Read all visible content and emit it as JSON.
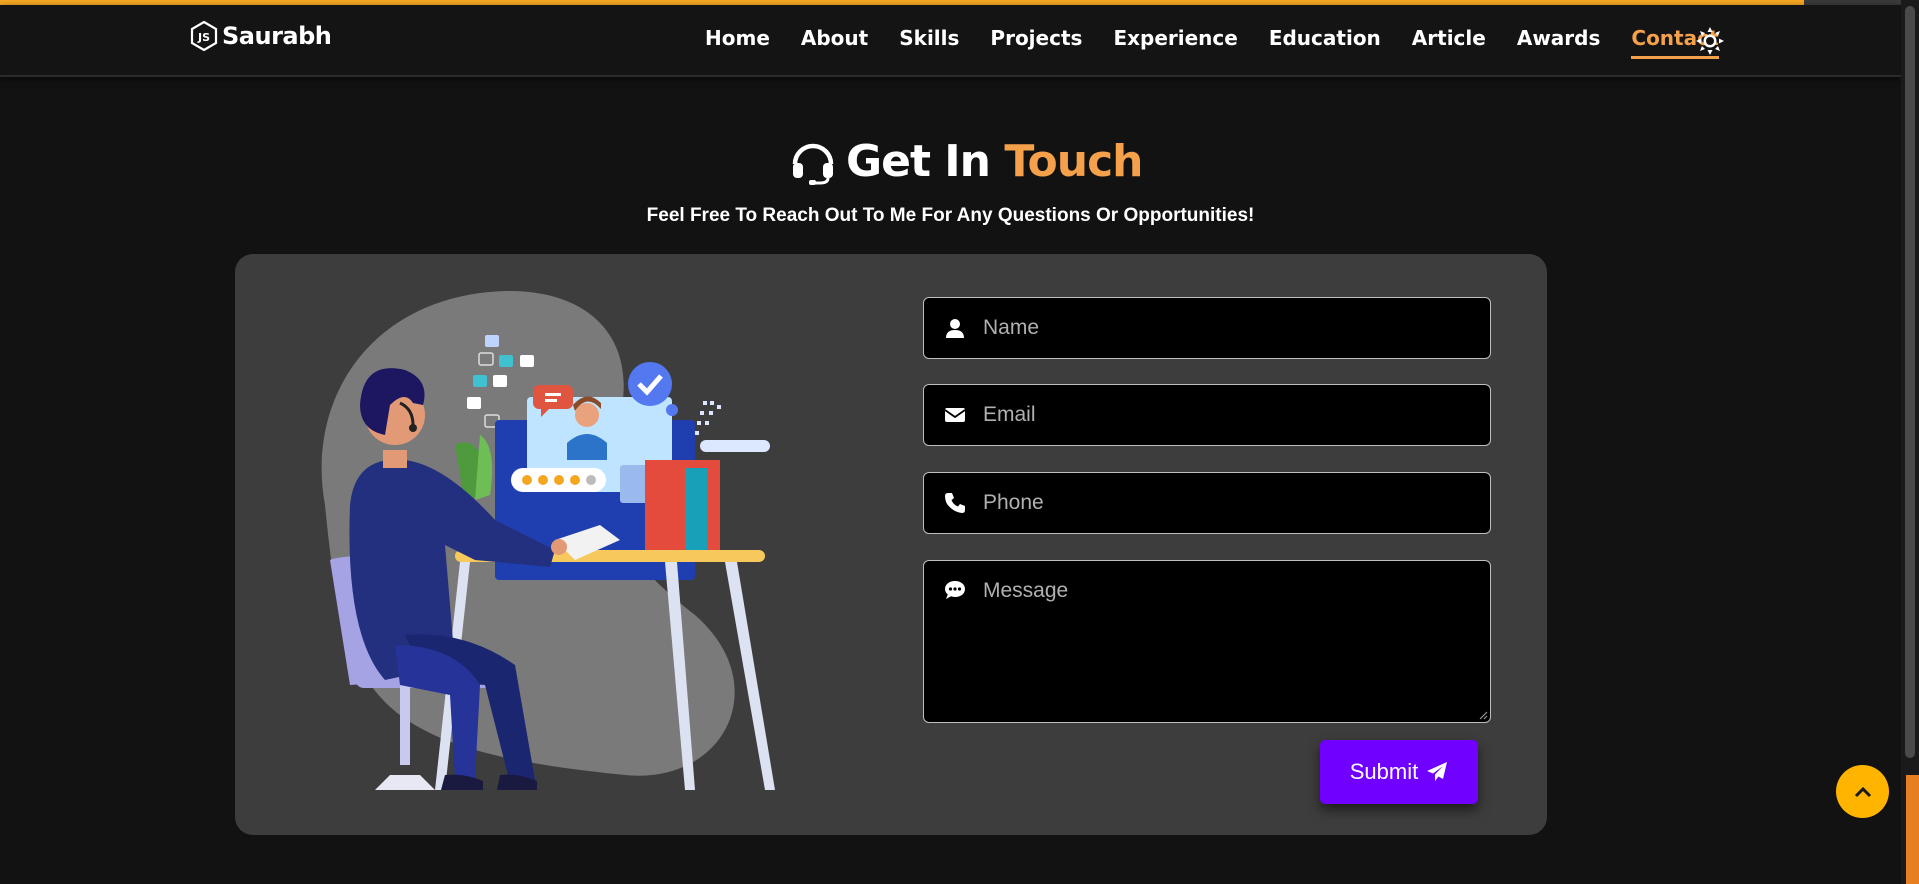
{
  "page": {
    "scroll_progress_percent": 94
  },
  "navbar": {
    "brand": "Saurabh",
    "logo_icon": "js-hexagon-icon",
    "links": [
      {
        "label": "Home",
        "active": false
      },
      {
        "label": "About",
        "active": false
      },
      {
        "label": "Skills",
        "active": false
      },
      {
        "label": "Projects",
        "active": false
      },
      {
        "label": "Experience",
        "active": false
      },
      {
        "label": "Education",
        "active": false
      },
      {
        "label": "Article",
        "active": false
      },
      {
        "label": "Awards",
        "active": false
      },
      {
        "label": "Contact",
        "active": true
      }
    ],
    "theme_toggle_icon": "sun-icon"
  },
  "contact": {
    "heading_main": "Get In",
    "heading_accent": "Touch",
    "heading_icon": "headset-icon",
    "subtitle": "Feel Free To Reach Out To Me For Any Questions Or Opportunities!",
    "fields": {
      "name": {
        "placeholder": "Name",
        "icon": "user-icon"
      },
      "email": {
        "placeholder": "Email",
        "icon": "envelope-icon"
      },
      "phone": {
        "placeholder": "Phone",
        "icon": "phone-icon"
      },
      "message": {
        "placeholder": "Message",
        "icon": "chat-bubble-icon"
      }
    },
    "submit_label": "Submit",
    "submit_icon": "paper-plane-icon"
  },
  "scroll_top_icon": "chevron-up-icon",
  "colors": {
    "background": "#121212",
    "card": "#3d3d3d",
    "accent_orange": "#f5a04a",
    "submit_purple": "#7000ff",
    "scroll_top_yellow": "#ffb400"
  }
}
